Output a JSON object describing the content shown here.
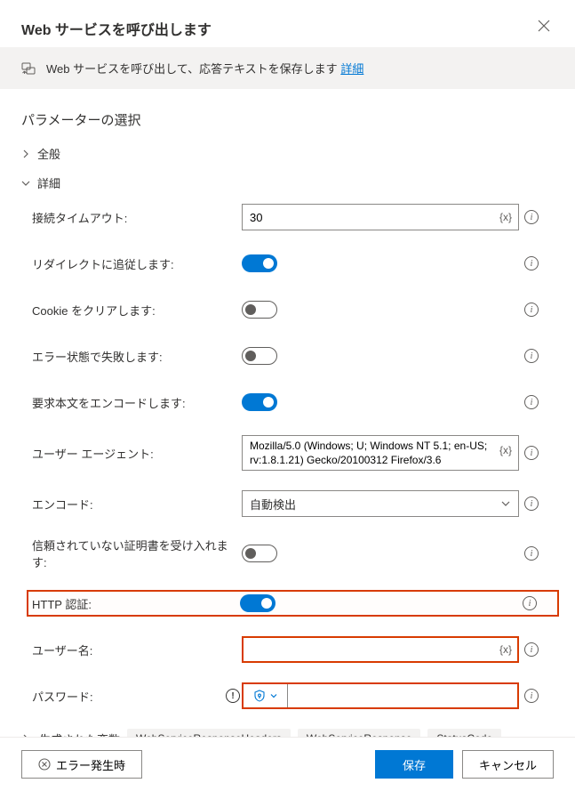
{
  "header": {
    "title": "Web サービスを呼び出します"
  },
  "banner": {
    "text": "Web サービスを呼び出して、応答テキストを保存します",
    "link": "詳細"
  },
  "section_title": "パラメーターの選択",
  "groups": {
    "general": "全般",
    "advanced": "詳細"
  },
  "fields": {
    "timeout": {
      "label": "接続タイムアウト:",
      "value": "30"
    },
    "follow_redirect": {
      "label": "リダイレクトに追従します:",
      "on": true
    },
    "clear_cookies": {
      "label": "Cookie をクリアします:",
      "on": false
    },
    "fail_on_error": {
      "label": "エラー状態で失敗します:",
      "on": false
    },
    "encode_body": {
      "label": "要求本文をエンコードします:",
      "on": true
    },
    "user_agent": {
      "label": "ユーザー エージェント:",
      "value": "Mozilla/5.0 (Windows; U; Windows NT 5.1; en-US; rv:1.8.1.21) Gecko/20100312 Firefox/3.6"
    },
    "encoding": {
      "label": "エンコード:",
      "value": "自動検出"
    },
    "accept_untrusted": {
      "label": "信頼されていない証明書を受け入れます:",
      "on": false
    },
    "http_auth": {
      "label": "HTTP 認証:",
      "on": true
    },
    "username": {
      "label": "ユーザー名:",
      "value": ""
    },
    "password": {
      "label": "パスワード:",
      "value": ""
    }
  },
  "var_badge": "{x}",
  "generated": {
    "label": "生成された変数",
    "chips": [
      "WebServiceResponseHeaders",
      "WebServiceResponse",
      "StatusCode"
    ]
  },
  "footer": {
    "error": "エラー発生時",
    "save": "保存",
    "cancel": "キャンセル"
  }
}
